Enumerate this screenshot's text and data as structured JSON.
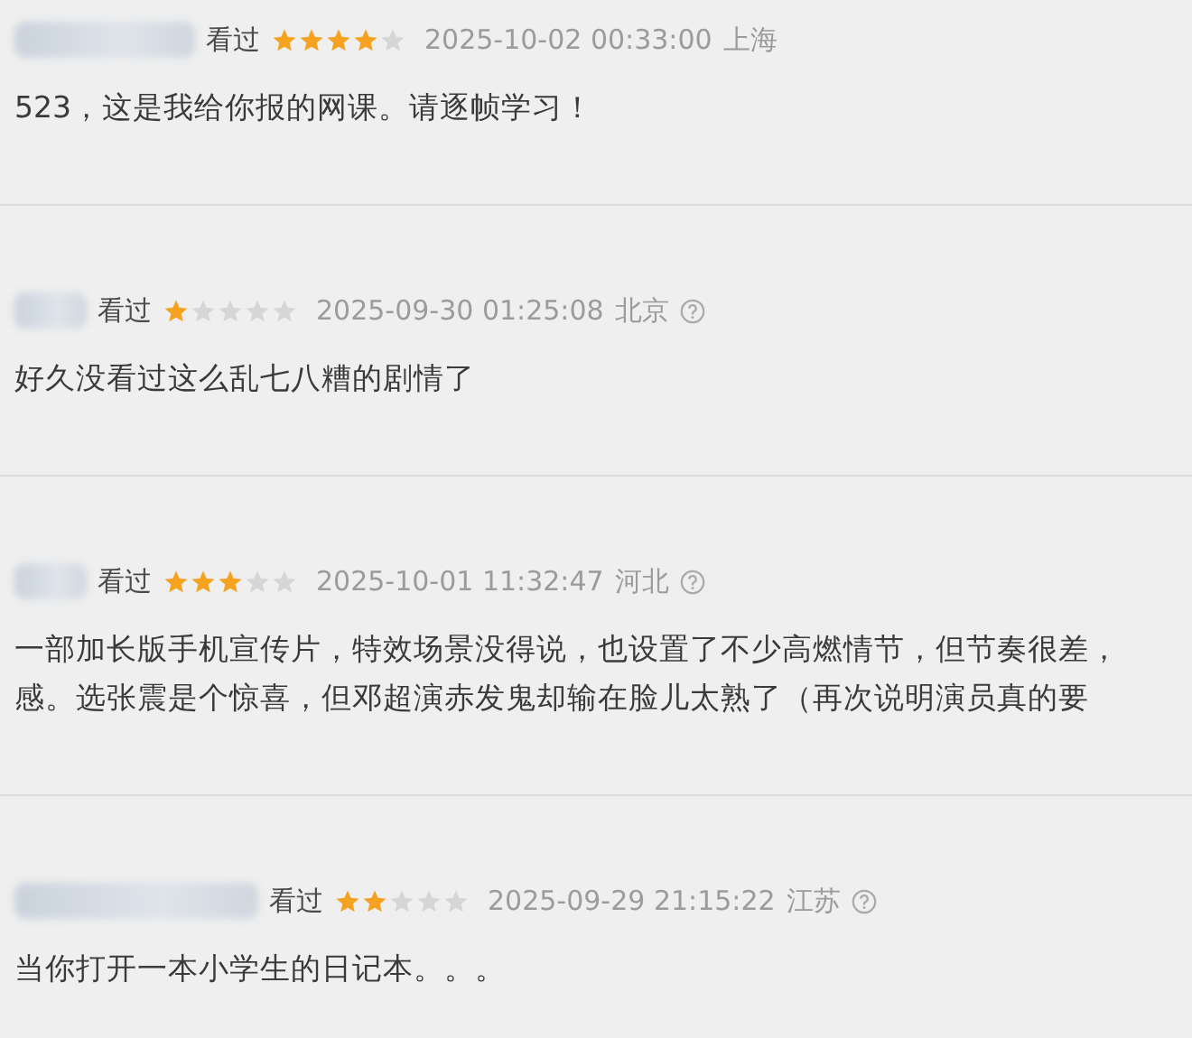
{
  "reviews": [
    {
      "status": "看过",
      "stars": 4,
      "time": "2025-10-02 00:33:00",
      "location": "上海",
      "help_icon": false,
      "lines": [
        "523，这是我给你报的网课。请逐帧学习！"
      ]
    },
    {
      "status": "看过",
      "stars": 1,
      "time": "2025-09-30 01:25:08",
      "location": "北京",
      "help_icon": true,
      "lines": [
        "好久没看过这么乱七八糟的剧情了"
      ]
    },
    {
      "status": "看过",
      "stars": 3,
      "time": "2025-10-01 11:32:47",
      "location": "河北",
      "help_icon": true,
      "lines": [
        "一部加长版手机宣传片，特效场景没得说，也设置了不少高燃情节，但节奏很差，",
        "感。选张震是个惊喜，但邓超演赤发鬼却输在脸儿太熟了（再次说明演员真的要"
      ]
    },
    {
      "status": "看过",
      "stars": 2,
      "time": "2025-09-29 21:15:22",
      "location": "江苏",
      "help_icon": true,
      "lines": [
        "当你打开一本小学生的日记本。。。"
      ]
    }
  ]
}
